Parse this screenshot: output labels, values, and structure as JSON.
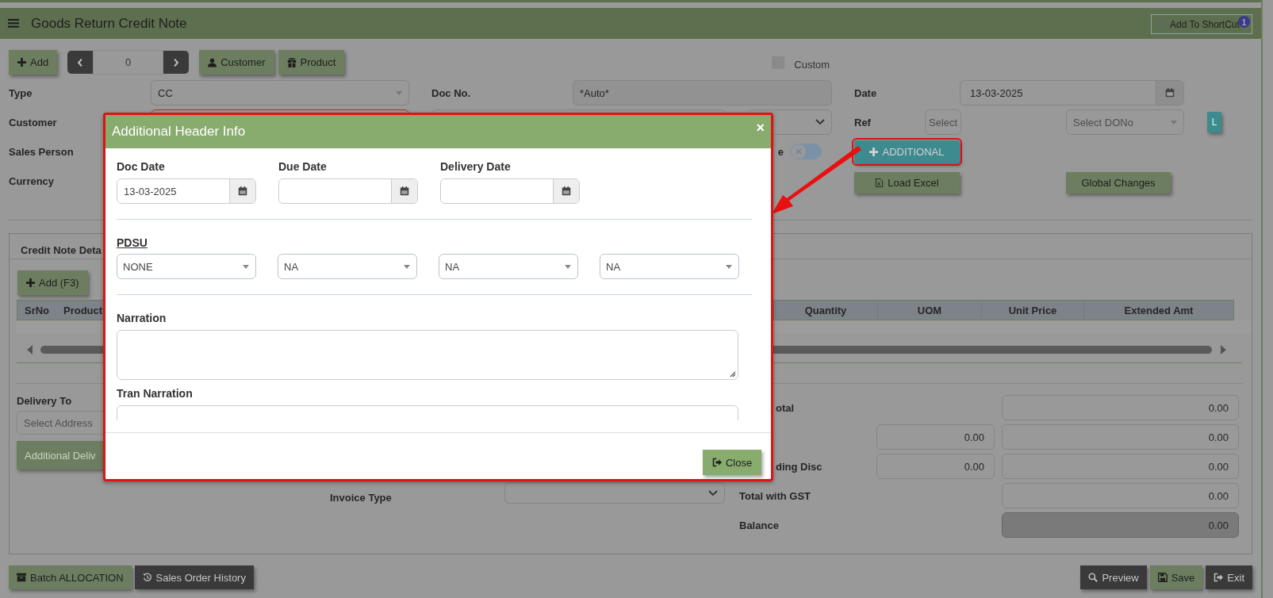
{
  "header": {
    "title": "Goods Return Credit Note",
    "shortcut_button": "Add To ShortCut",
    "shortcut_badge": "1"
  },
  "toolbar": {
    "add_button": "Add",
    "record_number": "0",
    "customer_button": "Customer",
    "product_button": "Product",
    "custom_checkbox": {
      "label": "Custom",
      "checked": false
    }
  },
  "form": {
    "type": {
      "label": "Type",
      "value": "CC"
    },
    "customer": {
      "label": "Customer",
      "invalid": true
    },
    "sales_person": {
      "label": "Sales Person"
    },
    "currency": {
      "label": "Currency"
    },
    "doc_no": {
      "label": "Doc No.",
      "value": "*Auto*"
    },
    "date": {
      "label": "Date",
      "value": "13-03-2025"
    },
    "ref": {
      "label": "Ref",
      "ref_placeholder": "Select",
      "dono_placeholder": "Select DONo"
    },
    "l_button": "L",
    "toggle": {
      "label": "e",
      "on": false
    },
    "additional_button": {
      "label": "ADDITIONAL",
      "highlighted": true
    },
    "load_excel_button": "Load Excel",
    "global_changes_button": "Global Changes"
  },
  "details": {
    "tab": "Credit Note Deta",
    "add_button": "Add (F3)",
    "columns": [
      "SrNo",
      "Product",
      "Quantity",
      "UOM",
      "Unit Price",
      "Extended Amt"
    ]
  },
  "delivery": {
    "label": "Delivery To",
    "placeholder": "Select Address",
    "button": "Additional Deliv"
  },
  "invoice_type": {
    "label": "Invoice Type"
  },
  "totals": [
    {
      "label": "otal",
      "clipped": true,
      "disabled": false,
      "values": [
        "0.00"
      ]
    },
    {
      "disabled": false,
      "values": [
        "0.00",
        "0.00"
      ]
    },
    {
      "label": "ding Disc",
      "clipped": true,
      "disabled": false,
      "values": [
        "0.00",
        "0.00"
      ]
    },
    {
      "label": "Total with GST",
      "clipped": false,
      "disabled": false,
      "values": [
        "0.00"
      ]
    },
    {
      "label": "Balance",
      "clipped": false,
      "disabled": true,
      "values": [
        "0.00"
      ]
    }
  ],
  "footer": {
    "left": [
      {
        "label": "Batch ALLOCATION",
        "kind": "accent"
      },
      {
        "label": "Sales Order History",
        "kind": "dark"
      }
    ],
    "right": [
      {
        "label": "Preview",
        "kind": "dark"
      },
      {
        "label": "Save",
        "kind": "accent"
      },
      {
        "label": "Exit",
        "kind": "dark"
      }
    ]
  },
  "dialog": {
    "title": "Additional Header Info",
    "close_glyph": "×",
    "dates": [
      {
        "label": "Doc Date",
        "value": "13-03-2025"
      },
      {
        "label": "Due Date"
      },
      {
        "label": "Delivery Date"
      }
    ],
    "pdsu": {
      "heading": "PDSU",
      "selects": [
        "NONE",
        "NA",
        "NA",
        "NA"
      ]
    },
    "narration_label": "Narration",
    "tran_narration_label": "Tran Narration",
    "close_button": "Close"
  }
}
